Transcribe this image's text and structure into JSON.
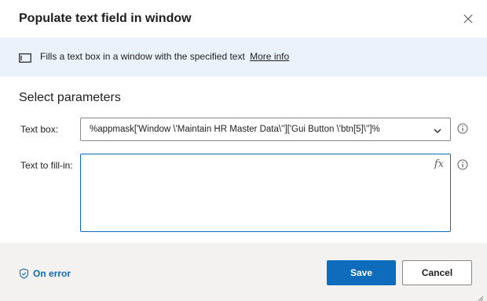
{
  "dialog": {
    "title": "Populate text field in window",
    "close_icon": "close-icon"
  },
  "banner": {
    "icon": "window-icon",
    "text": "Fills a text box in a window with the specified text",
    "link_label": "More info"
  },
  "section": {
    "title": "Select parameters"
  },
  "fields": {
    "text_box": {
      "label": "Text box:",
      "value": "%appmask['Window \\'Maintain HR Master Data\\'']['Gui Button \\'btn[5]\\'']%"
    },
    "text_to_fill": {
      "label": "Text to fill-in:",
      "value": "",
      "fx_label": "fx"
    }
  },
  "footer": {
    "on_error_label": "On error",
    "save_label": "Save",
    "cancel_label": "Cancel"
  },
  "colors": {
    "accent": "#0f6cbd",
    "banner_bg": "#eaf2fb",
    "footer_bg": "#f3f2f1"
  }
}
